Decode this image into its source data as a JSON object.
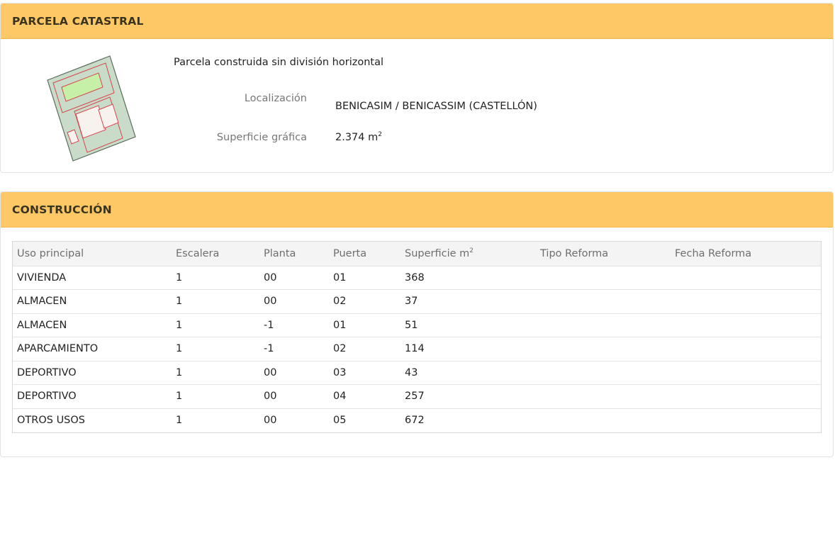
{
  "parcela": {
    "header": "PARCELA CATASTRAL",
    "type": "Parcela construida sin división horizontal",
    "localizacion_label": "Localización",
    "localizacion_value": "BENICASIM / BENICASSIM (CASTELLÓN)",
    "superficie_label": "Superficie gráfica",
    "superficie_value": "2.374 m",
    "superficie_unit_exp": "2",
    "plot_colors": {
      "ground": "#c9dcc9",
      "outline": "#d9434e",
      "pool": "#c6f0a8",
      "building": "#f7f2ee"
    }
  },
  "construccion": {
    "header": "CONSTRUCCIÓN",
    "columns": {
      "uso": "Uso principal",
      "escalera": "Escalera",
      "planta": "Planta",
      "puerta": "Puerta",
      "superficie": "Superficie m",
      "superficie_exp": "2",
      "tipo_reforma": "Tipo Reforma",
      "fecha_reforma": "Fecha Reforma"
    },
    "rows": [
      {
        "uso": "VIVIENDA",
        "escalera": "1",
        "planta": "00",
        "puerta": "01",
        "superficie": "368",
        "tipo_reforma": "",
        "fecha_reforma": ""
      },
      {
        "uso": "ALMACEN",
        "escalera": "1",
        "planta": "00",
        "puerta": "02",
        "superficie": "37",
        "tipo_reforma": "",
        "fecha_reforma": ""
      },
      {
        "uso": "ALMACEN",
        "escalera": "1",
        "planta": "-1",
        "puerta": "01",
        "superficie": "51",
        "tipo_reforma": "",
        "fecha_reforma": ""
      },
      {
        "uso": "APARCAMIENTO",
        "escalera": "1",
        "planta": "-1",
        "puerta": "02",
        "superficie": "114",
        "tipo_reforma": "",
        "fecha_reforma": ""
      },
      {
        "uso": "DEPORTIVO",
        "escalera": "1",
        "planta": "00",
        "puerta": "03",
        "superficie": "43",
        "tipo_reforma": "",
        "fecha_reforma": ""
      },
      {
        "uso": "DEPORTIVO",
        "escalera": "1",
        "planta": "00",
        "puerta": "04",
        "superficie": "257",
        "tipo_reforma": "",
        "fecha_reforma": ""
      },
      {
        "uso": "OTROS USOS",
        "escalera": "1",
        "planta": "00",
        "puerta": "05",
        "superficie": "672",
        "tipo_reforma": "",
        "fecha_reforma": ""
      }
    ]
  }
}
